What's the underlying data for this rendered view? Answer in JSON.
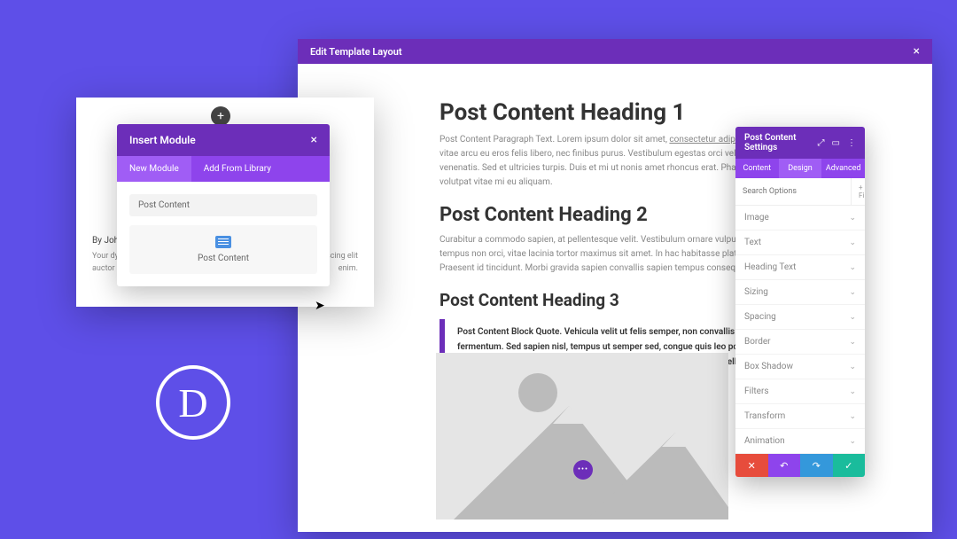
{
  "edit_window": {
    "title": "Edit Template Layout",
    "h1": "Post Content Heading 1",
    "p1": "Post Content Paragraph Text. Lorem ipsum dolor sit amet, consectetur adipiscing elit. Ut vitae arcu eu eros felis libero, nec finibus purus. Vestibulum egestas orci vel ornare venenatis. Sed et ultricies turpis. Duis et mi ut nonis amet rhoncus erat. Phasellus volutpat vitae mi eu aliquam.",
    "p1_link": "consectetur adipiscing elit",
    "h2": "Post Content Heading 2",
    "p2": "Curabitur a commodo sapien, at pellentesque velit. Vestibulum ornare vulputate. Mauris tempus non orci, vitae lacinia tortor maximus sit amet. In hac habitasse platea dictumst. Praesent id tincidunt. Morbi gravida sapien convallis sapien tempus consequat.",
    "h3": "Post Content Heading 3",
    "blockquote": "Post Content Block Quote. Vehicula velit ut felis semper, non convallis arcu fermentum. Sed sapien nisl, tempus ut semper sed, congue quis leo posuere nec suscipit lacus. Duis luctus eros dui, nec finibus lectus tempor non. Pellentesque at tincidunt turpis."
  },
  "left_card": {
    "author": "By John Doe",
    "desc_left": "Your dynamic",
    "desc_right": "etur adipiscing elit",
    "desc_end": "auctor urna el",
    "desc_tail": "enim."
  },
  "insert_modal": {
    "title": "Insert Module",
    "tabs": {
      "new": "New Module",
      "library": "Add From Library"
    },
    "search_value": "Post Content",
    "module_item": "Post Content"
  },
  "settings": {
    "title": "Post Content Settings",
    "tabs": {
      "content": "Content",
      "design": "Design",
      "advanced": "Advanced"
    },
    "search_placeholder": "Search Options",
    "filter_label": "+ Filter",
    "rows": [
      "Image",
      "Text",
      "Heading Text",
      "Sizing",
      "Spacing",
      "Border",
      "Box Shadow",
      "Filters",
      "Transform",
      "Animation"
    ]
  },
  "logo": "D",
  "colors": {
    "bg": "#5e4fe8",
    "accent": "#6c2eb9",
    "accent_light": "#8e44ec"
  }
}
